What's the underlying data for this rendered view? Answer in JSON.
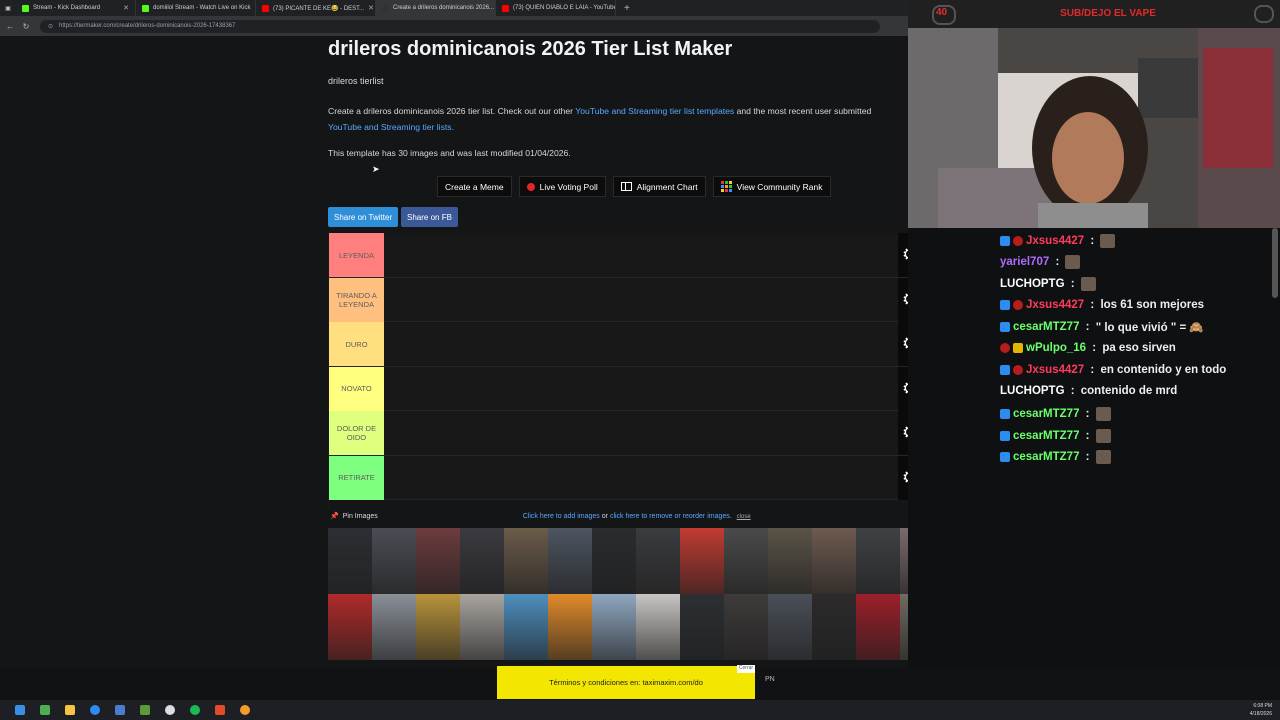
{
  "browser": {
    "tabs": [
      {
        "title": "Stream - Kick Dashboard",
        "color": "#53fc18"
      },
      {
        "title": "domiilol Stream - Watch Live on Kick",
        "color": "#53fc18"
      },
      {
        "title": "(73) PICANTE DE KE😂 - DEST...",
        "color": "#ff0000"
      },
      {
        "title": "Create a drileros dominicanois 2026...",
        "color": "#333333"
      },
      {
        "title": "(73) QUIEN DIABLO E LAIA - YouTube",
        "color": "#ff0000"
      }
    ],
    "url": "https://tiermaker.com/create/drileros-dominicanois-2026-17438367"
  },
  "page": {
    "title": "drileros dominicanois 2026 Tier List Maker",
    "subtitle": "drileros tierlist",
    "desc_a": "Create a drileros dominicanois 2026 tier list. Check out our other ",
    "desc_link1": "YouTube and Streaming tier list templates",
    "desc_b": " and the most recent user submitted ",
    "desc_link2": "YouTube and Streaming tier lists.",
    "info": "This template has 30 images and was last modified 01/04/2026.",
    "buttons": {
      "meme": "Create a Meme",
      "voting": "Live Voting Poll",
      "alignment": "Alignment Chart",
      "community": "View Community Rank"
    },
    "share": {
      "twitter": "Share on Twitter",
      "fb": "Share on FB"
    },
    "tiers": [
      {
        "label": "LEYENDA",
        "color": "#ff7f7f"
      },
      {
        "label": "TIRANDO A LEYENDA",
        "color": "#ffbf7f"
      },
      {
        "label": "DURO",
        "color": "#ffdf7f"
      },
      {
        "label": "NOVATO",
        "color": "#ffff7f"
      },
      {
        "label": "DOLOR DE OIDO",
        "color": "#dfff7f"
      },
      {
        "label": "RETIRATE",
        "color": "#7fff7f"
      }
    ],
    "pin_label": "Pin Images",
    "hint_add": "Click here to add images",
    "hint_or": "or",
    "hint_remove": "click here to remove or reorder images.",
    "hint_close": "close",
    "thumb_colors": [
      "#2b2f33",
      "#4a4d55",
      "#6c3c3e",
      "#3a3a40",
      "#6b5b4a",
      "#4d5560",
      "#2a2c2e",
      "#3b3c3f",
      "#c23b33",
      "#4a4a4a",
      "#5a5347",
      "#6e5a50",
      "#3f4245",
      "#7a6b6e",
      "#b02a2a",
      "#8a8f98",
      "#b8933a",
      "#a9a4a0",
      "#4d8fbf",
      "#e08b2a",
      "#8fa7c0",
      "#c8c6c4",
      "#2d2f33",
      "#3e3b3a",
      "#4a5058",
      "#2c2a2b",
      "#9c1f2a",
      "#6f6a62"
    ],
    "ad_text": "Términos y condiciones en: taximaxim.com/do",
    "ad_close": "Cerrar",
    "ad_pn": "PN"
  },
  "stream": {
    "counter": "40",
    "banner": "SUB/DEJO EL VAPE"
  },
  "chat": [
    {
      "user": "Jxsus4427",
      "color": "#ff3c5c",
      "badges": [
        "blue",
        "red"
      ],
      "text": "",
      "emote": true
    },
    {
      "user": "yariel707",
      "color": "#b06cff",
      "badges": [],
      "text": "",
      "emote": true
    },
    {
      "user": "LUCHOPTG",
      "color": "#ffffff",
      "badges": [],
      "text": "",
      "emote": true
    },
    {
      "user": "Jxsus4427",
      "color": "#ff3c5c",
      "badges": [
        "blue",
        "red"
      ],
      "text": "los 61 son mejores",
      "emote": false
    },
    {
      "user": "cesarMTZ77",
      "color": "#6cff6c",
      "badges": [
        "blue"
      ],
      "text": "\" lo que vivió \" = 🙈",
      "emote": false
    },
    {
      "user": "wPulpo_16",
      "color": "#6cff6c",
      "badges": [
        "red",
        "yel"
      ],
      "text": "pa eso sirven",
      "emote": false
    },
    {
      "user": "Jxsus4427",
      "color": "#ff3c5c",
      "badges": [
        "blue",
        "red"
      ],
      "text": "en contenido y en todo",
      "emote": false
    },
    {
      "user": "LUCHOPTG",
      "color": "#ffffff",
      "badges": [],
      "text": "contenido de mrd",
      "emote": false
    },
    {
      "user": "cesarMTZ77",
      "color": "#6cff6c",
      "badges": [
        "blue"
      ],
      "text": "",
      "emote": true
    },
    {
      "user": "cesarMTZ77",
      "color": "#6cff6c",
      "badges": [
        "blue"
      ],
      "text": "",
      "emote": true
    },
    {
      "user": "cesarMTZ77",
      "color": "#6cff6c",
      "badges": [
        "blue"
      ],
      "text": "",
      "emote": true
    }
  ],
  "taskbar": {
    "time": "6:08 PM",
    "date": "4/18/2026"
  }
}
